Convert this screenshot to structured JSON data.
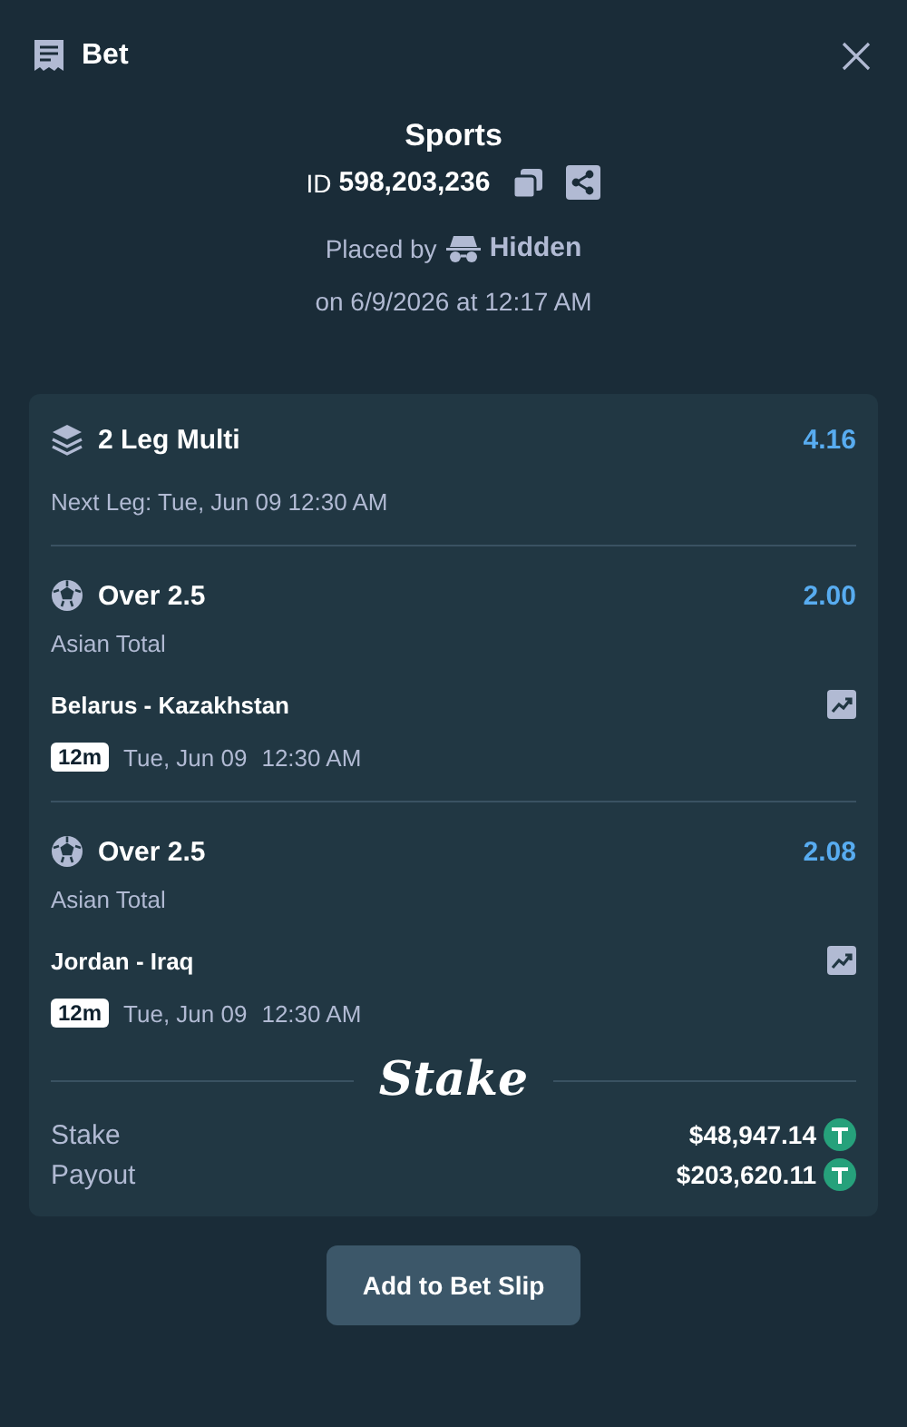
{
  "header": {
    "title": "Bet"
  },
  "summary": {
    "category": "Sports",
    "id_label": "ID",
    "id_value": "598,203,236",
    "placed_by_label": "Placed by",
    "placed_by_name": "Hidden",
    "placed_on": "on 6/9/2026 at 12:17 AM"
  },
  "multi": {
    "title": "2 Leg Multi",
    "odds": "4.16",
    "next_leg": "Next Leg: Tue, Jun 09 12:30 AM"
  },
  "legs": [
    {
      "selection": "Over 2.5",
      "odds": "2.00",
      "market": "Asian Total",
      "match": "Belarus - Kazakhstan",
      "countdown": "12m",
      "date": "Tue, Jun 09",
      "time": "12:30 AM"
    },
    {
      "selection": "Over 2.5",
      "odds": "2.08",
      "market": "Asian Total",
      "match": "Jordan - Iraq",
      "countdown": "12m",
      "date": "Tue, Jun 09",
      "time": "12:30 AM"
    }
  ],
  "brand": "Stake",
  "totals": [
    {
      "label": "Stake",
      "amount": "$48,947.14"
    },
    {
      "label": "Payout",
      "amount": "$203,620.11"
    }
  ],
  "button": "Add to Bet Slip"
}
